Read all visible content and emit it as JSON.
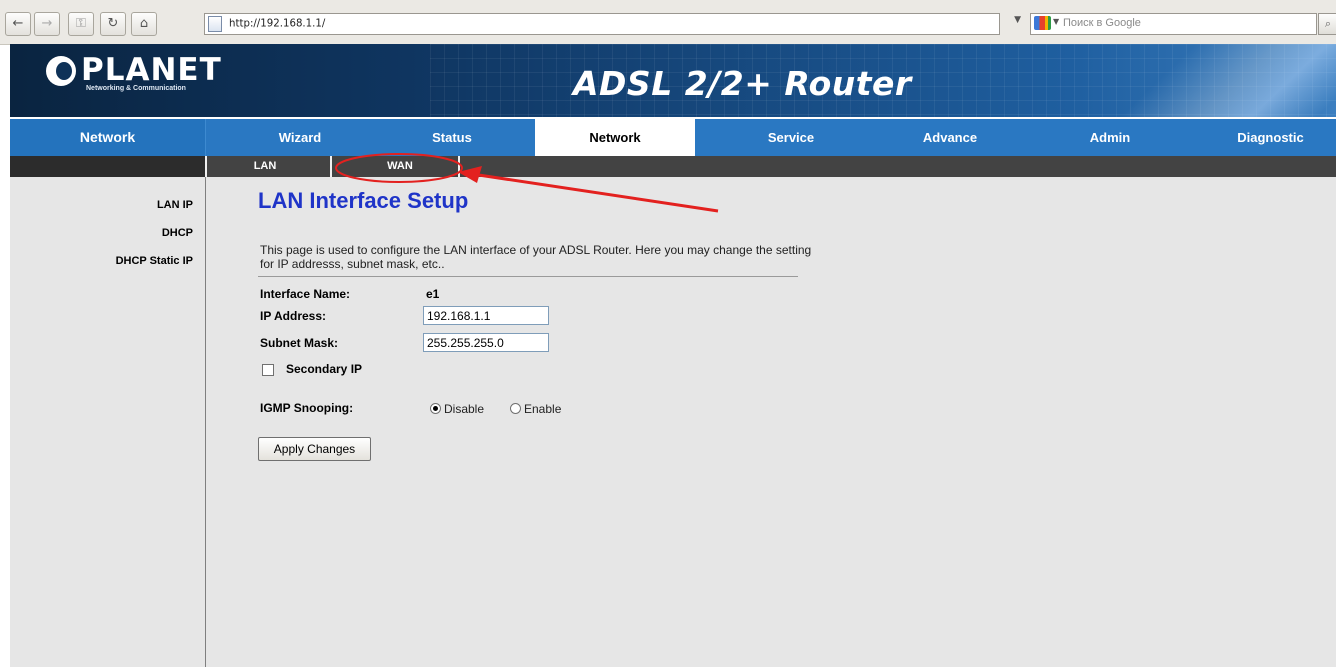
{
  "browser": {
    "url": "http://192.168.1.1/",
    "search_placeholder": "Поиск в Google"
  },
  "banner": {
    "logo_word": "PLANET",
    "logo_tagline": "Networking & Communication",
    "product": "ADSL 2/2+ Router"
  },
  "nav": {
    "section": "Network",
    "tabs": [
      {
        "label": "Wizard"
      },
      {
        "label": "Status"
      },
      {
        "label": "Network",
        "active": true
      },
      {
        "label": "Service"
      },
      {
        "label": "Advance"
      },
      {
        "label": "Admin"
      },
      {
        "label": "Diagnostic"
      }
    ],
    "subtabs": [
      {
        "label": "LAN",
        "active": true
      },
      {
        "label": "WAN"
      }
    ]
  },
  "sidebar": {
    "items": [
      {
        "label": "LAN IP"
      },
      {
        "label": "DHCP"
      },
      {
        "label": "DHCP Static IP"
      }
    ]
  },
  "page": {
    "title": "LAN Interface Setup",
    "description": "This page is used to configure the LAN interface of your ADSL Router. Here you may change the setting for IP addresss, subnet mask, etc..",
    "interface_name_label": "Interface Name:",
    "interface_name_value": "e1",
    "ip_label": "IP Address:",
    "ip_value": "192.168.1.1",
    "mask_label": "Subnet Mask:",
    "mask_value": "255.255.255.0",
    "secondary_ip_label": "Secondary IP",
    "secondary_ip_checked": false,
    "igmp_label": "IGMP Snooping:",
    "igmp_options": [
      {
        "label": "Disable",
        "selected": true
      },
      {
        "label": "Enable",
        "selected": false
      }
    ],
    "apply_label": "Apply Changes"
  },
  "colors": {
    "title_blue": "#1f34c8",
    "nav_blue": "#2a78c2",
    "annotation_red": "#e3211f"
  }
}
